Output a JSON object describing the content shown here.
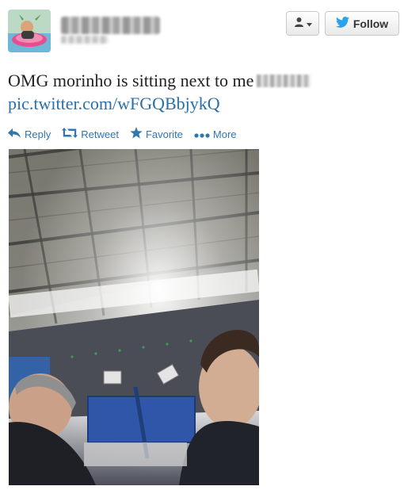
{
  "tweet": {
    "text": "OMG morinho is sitting next to me",
    "link": "pic.twitter.com/wFGQBbjykQ"
  },
  "header": {
    "follow_label": "Follow"
  },
  "actions": [
    {
      "label": "Reply",
      "icon": "reply-icon"
    },
    {
      "label": "Retweet",
      "icon": "retweet-icon"
    },
    {
      "label": "Favorite",
      "icon": "star-icon"
    },
    {
      "label": "More",
      "icon": "more-dots-icon"
    }
  ],
  "colors": {
    "link": "#2a6fa8",
    "twitter_blue": "#3176ad",
    "bird": "#2aa3ef"
  }
}
